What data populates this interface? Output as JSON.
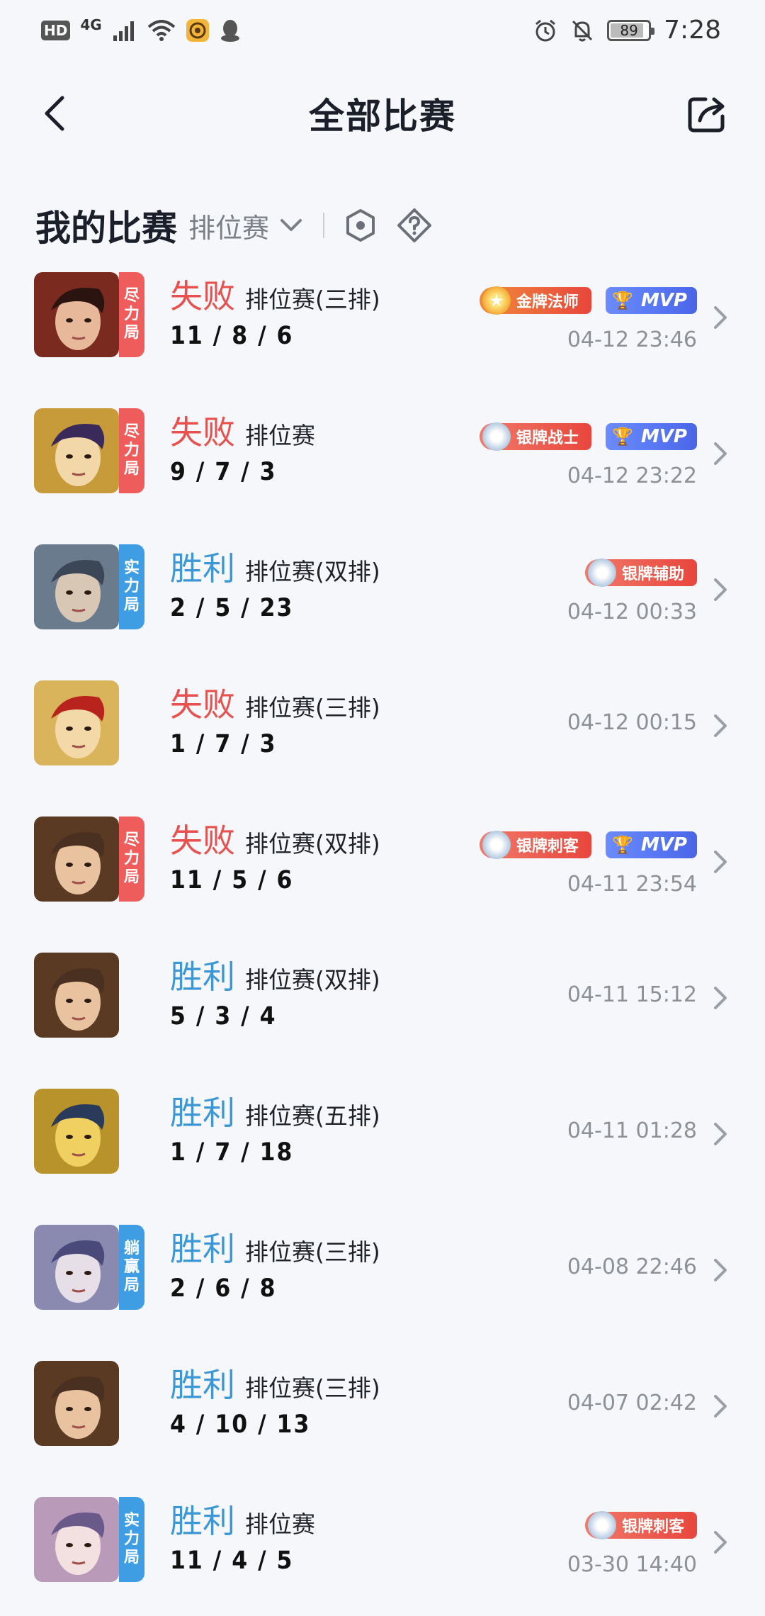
{
  "status_bar": {
    "hd": "HD",
    "network": "4G",
    "battery": "89",
    "battery_level": 0.89,
    "time": "7:28"
  },
  "header": {
    "title": "全部比赛"
  },
  "filter": {
    "section_title": "我的比赛",
    "mode_select": "排位赛"
  },
  "matches": [
    {
      "tag": "尽力局",
      "tag_color": "red",
      "result": "失败",
      "result_type": "lose",
      "mode": "排位赛(三排)",
      "kda": "11 / 8 / 6",
      "time": "04-12 23:46",
      "badges": [
        {
          "type": "gold",
          "label": "金牌法师"
        },
        {
          "type": "mvp",
          "label": "MVP"
        }
      ]
    },
    {
      "tag": "尽力局",
      "tag_color": "red",
      "result": "失败",
      "result_type": "lose",
      "mode": "排位赛",
      "kda": "9 / 7 / 3",
      "time": "04-12 23:22",
      "badges": [
        {
          "type": "silver",
          "label": "银牌战士"
        },
        {
          "type": "mvp",
          "label": "MVP"
        }
      ]
    },
    {
      "tag": "实力局",
      "tag_color": "blue",
      "result": "胜利",
      "result_type": "win",
      "mode": "排位赛(双排)",
      "kda": "2 / 5 / 23",
      "time": "04-12 00:33",
      "badges": [
        {
          "type": "silver",
          "label": "银牌辅助"
        }
      ]
    },
    {
      "tag": "",
      "tag_color": "",
      "result": "失败",
      "result_type": "lose",
      "mode": "排位赛(三排)",
      "kda": "1 / 7 / 3",
      "time": "04-12 00:15",
      "badges": []
    },
    {
      "tag": "尽力局",
      "tag_color": "red",
      "result": "失败",
      "result_type": "lose",
      "mode": "排位赛(双排)",
      "kda": "11 / 5 / 6",
      "time": "04-11 23:54",
      "badges": [
        {
          "type": "silver",
          "label": "银牌刺客"
        },
        {
          "type": "mvp",
          "label": "MVP"
        }
      ]
    },
    {
      "tag": "",
      "tag_color": "",
      "result": "胜利",
      "result_type": "win",
      "mode": "排位赛(双排)",
      "kda": "5 / 3 / 4",
      "time": "04-11 15:12",
      "badges": []
    },
    {
      "tag": "",
      "tag_color": "",
      "result": "胜利",
      "result_type": "win",
      "mode": "排位赛(五排)",
      "kda": "1 / 7 / 18",
      "time": "04-11 01:28",
      "badges": []
    },
    {
      "tag": "躺赢局",
      "tag_color": "blue",
      "result": "胜利",
      "result_type": "win",
      "mode": "排位赛(三排)",
      "kda": "2 / 6 / 8",
      "time": "04-08 22:46",
      "badges": []
    },
    {
      "tag": "",
      "tag_color": "",
      "result": "胜利",
      "result_type": "win",
      "mode": "排位赛(三排)",
      "kda": "4 / 10 / 13",
      "time": "04-07 02:42",
      "badges": []
    },
    {
      "tag": "实力局",
      "tag_color": "blue",
      "result": "胜利",
      "result_type": "win",
      "mode": "排位赛",
      "kda": "11 / 4 / 5",
      "time": "03-30 14:40",
      "badges": [
        {
          "type": "silver",
          "label": "银牌刺客"
        }
      ]
    }
  ],
  "colors": {
    "lose": "#e8504e",
    "win": "#3d97d6",
    "tag_red": "#ef5c5c",
    "tag_blue": "#3f9de3"
  }
}
